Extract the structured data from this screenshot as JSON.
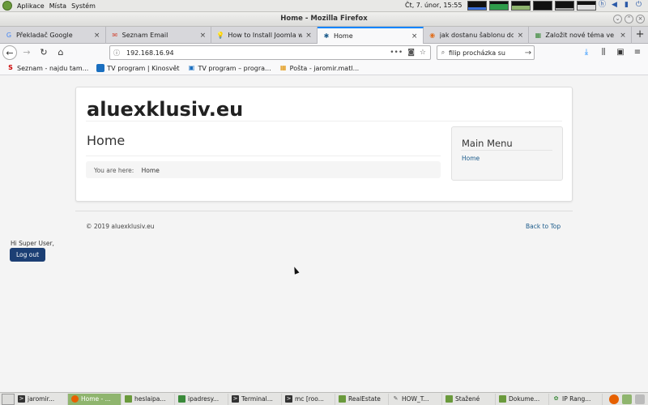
{
  "top_panel": {
    "menus": [
      "Aplikace",
      "Místa",
      "Systém"
    ],
    "clock": "Čt, 7. únor, 15:55"
  },
  "window": {
    "title": "Home - Mozilla Firefox"
  },
  "tabs": [
    {
      "label": "Překladač Google",
      "favicon": "G",
      "color": "#4285f4"
    },
    {
      "label": "Seznam Email",
      "favicon": "✉",
      "color": "#d14836"
    },
    {
      "label": "How to Install Joomla w",
      "favicon": "💡",
      "color": "#e6b800"
    },
    {
      "label": "Home",
      "favicon": "✱",
      "color": "#1a5a8a",
      "active": true
    },
    {
      "label": "jak dostanu šablonu do",
      "favicon": "◉",
      "color": "#e07020"
    },
    {
      "label": "Založit nové téma ve F",
      "favicon": "▦",
      "color": "#3a8a3a"
    }
  ],
  "navbar": {
    "url": "192.168.16.94",
    "search_value": "filip procházka su"
  },
  "bookmarks": [
    {
      "label": "Seznam - najdu tam...",
      "icon": "S",
      "color": "#cc0000"
    },
    {
      "label": "TV program | Kinosvět",
      "icon": "▪",
      "color": "#1a6fc0"
    },
    {
      "label": "TV program – progra...",
      "icon": "▪",
      "color": "#1a6fc0"
    },
    {
      "label": "Pošta - jaromir.matl...",
      "icon": "▦",
      "color": "#e09000"
    }
  ],
  "page": {
    "brand": "aluexklusiv.eu",
    "heading": "Home",
    "breadcrumb_prefix": "You are here:",
    "breadcrumb_home": "Home",
    "menu_title": "Main Menu",
    "menu_link": "Home",
    "copyright": "© 2019 aluexklusiv.eu",
    "back_to_top": "Back to Top",
    "greeting": "Hi Super User,",
    "logout_label": "Log out"
  },
  "taskbar": [
    {
      "label": "jaromir...",
      "icon": ">",
      "color": "#333333"
    },
    {
      "label": "Home - ...",
      "icon": "●",
      "color": "#e66000",
      "active": true
    },
    {
      "label": "heslaipa...",
      "icon": "▭",
      "color": "#6a9a3c"
    },
    {
      "label": "ipadresy...",
      "icon": "▤",
      "color": "#3a8a3a"
    },
    {
      "label": "Terminal...",
      "icon": ">",
      "color": "#333333"
    },
    {
      "label": "mc [roo...",
      "icon": ">",
      "color": "#333333"
    },
    {
      "label": "RealEstate",
      "icon": "▭",
      "color": "#6a9a3c"
    },
    {
      "label": "HOW_T...",
      "icon": "✎",
      "color": "#555555"
    },
    {
      "label": "Stažené",
      "icon": "▭",
      "color": "#6a9a3c"
    },
    {
      "label": "Dokume...",
      "icon": "▭",
      "color": "#6a9a3c"
    },
    {
      "label": "IP Rang...",
      "icon": "✿",
      "color": "#3a8a3a"
    }
  ]
}
